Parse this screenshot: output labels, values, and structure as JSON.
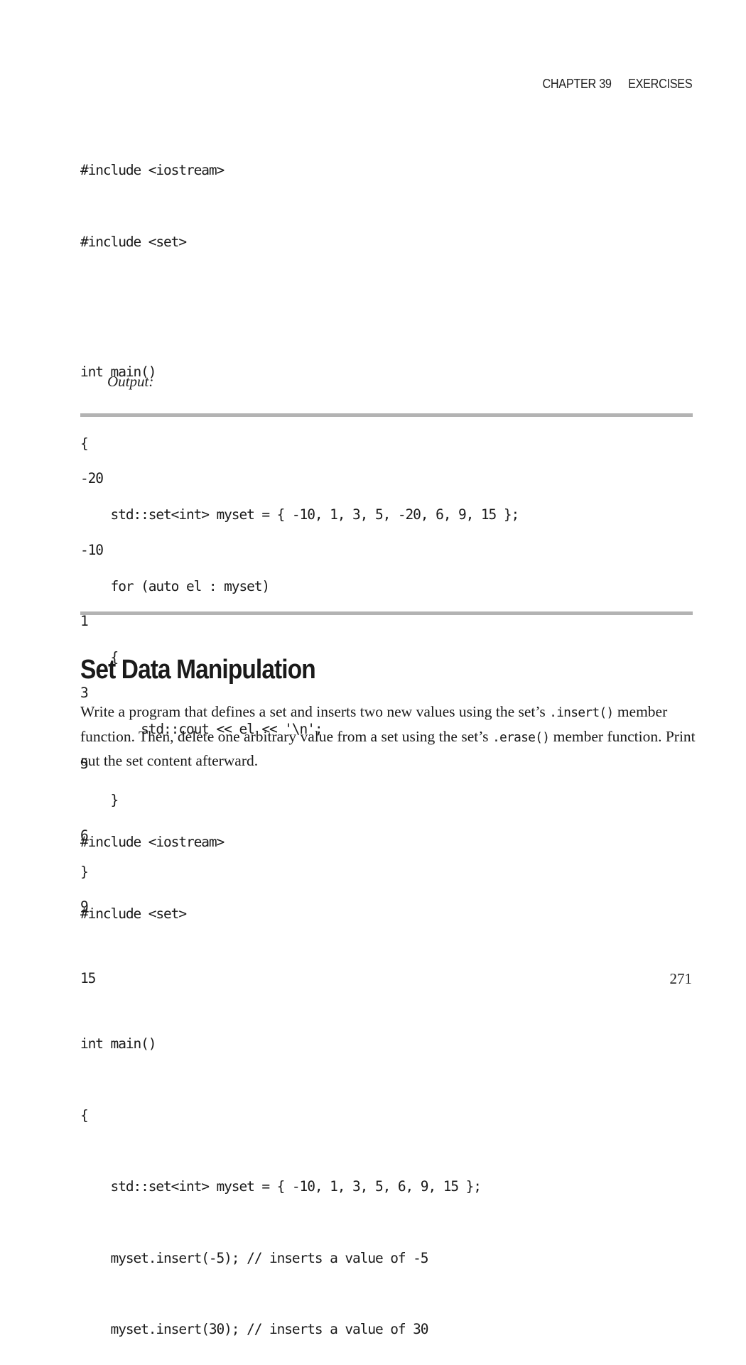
{
  "running_head": {
    "chapter": "CHAPTER 39",
    "title": "EXERCISES"
  },
  "code_block_1": {
    "lines": [
      "#include <iostream>",
      "#include <set>",
      "",
      "int main()",
      "{",
      "    std::set<int> myset = { -10, 1, 3, 5, -20, 6, 9, 15 };",
      "    for (auto el : myset)",
      "    {",
      "        std::cout << el << '\\n';",
      "    }",
      "}"
    ]
  },
  "output_label": "Output:",
  "output_block": {
    "lines": [
      "-20",
      "-10",
      "1",
      "3",
      "5",
      "6",
      "9",
      "15"
    ]
  },
  "section": {
    "title": "Set Data Manipulation",
    "paragraph": {
      "part1": "Write a program that defines a set and inserts two new values using the set’s ",
      "code1": ".insert()",
      "part2": " member function. Then, delete one arbitrary value from a set using the set’s ",
      "code2": ".erase()",
      "part3": " member function. Print out the set content afterward."
    }
  },
  "code_block_2": {
    "lines": [
      "#include <iostream>",
      "#include <set>",
      "",
      "int main()",
      "{",
      "    std::set<int> myset = { -10, 1, 3, 5, 6, 9, 15 };",
      "    myset.insert(-5); // inserts a value of -5",
      "    myset.insert(30); // inserts a value of 30"
    ]
  },
  "page_number": "271"
}
